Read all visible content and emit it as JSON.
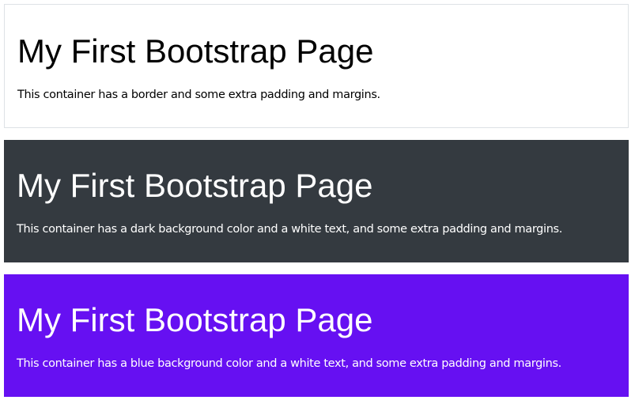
{
  "containers": [
    {
      "title": "My First Bootstrap Page",
      "text": "This container has a border and some extra padding and margins."
    },
    {
      "title": "My First Bootstrap Page",
      "text": "This container has a dark background color and a white text, and some extra padding and margins."
    },
    {
      "title": "My First Bootstrap Page",
      "text": "This container has a blue background color and a white text, and some extra padding and margins."
    }
  ],
  "colors": {
    "border": "#dee2e6",
    "dark_bg": "#343a40",
    "blue_bg": "#6610f2",
    "text_dark": "#000000",
    "text_light": "#ffffff"
  }
}
